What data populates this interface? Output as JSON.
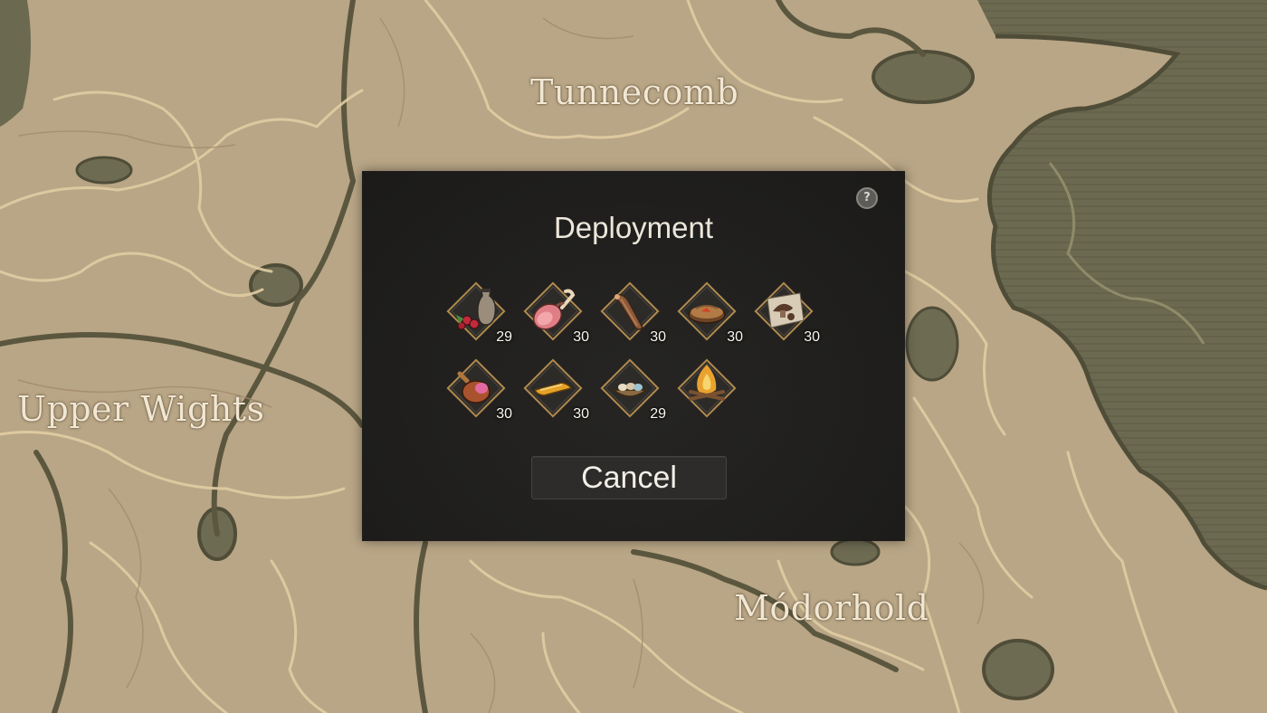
{
  "map": {
    "regions": [
      "Tunnecomb",
      "Upper Wights",
      "Módorhold"
    ]
  },
  "dialog": {
    "title": "Deployment",
    "help_label": "?",
    "cancel_label": "Cancel",
    "items": [
      {
        "icon": "jar-and-berries-icon",
        "count": "29"
      },
      {
        "icon": "ham-leg-icon",
        "count": "30"
      },
      {
        "icon": "cured-sausage-icon",
        "count": "30"
      },
      {
        "icon": "pie-icon",
        "count": "30"
      },
      {
        "icon": "mushroom-icon",
        "count": "30"
      },
      {
        "icon": "roast-meat-icon",
        "count": "30"
      },
      {
        "icon": "bread-loaf-icon",
        "count": "30"
      },
      {
        "icon": "egg-basket-icon",
        "count": "29"
      },
      {
        "icon": "campfire-icon",
        "count": ""
      }
    ]
  }
}
